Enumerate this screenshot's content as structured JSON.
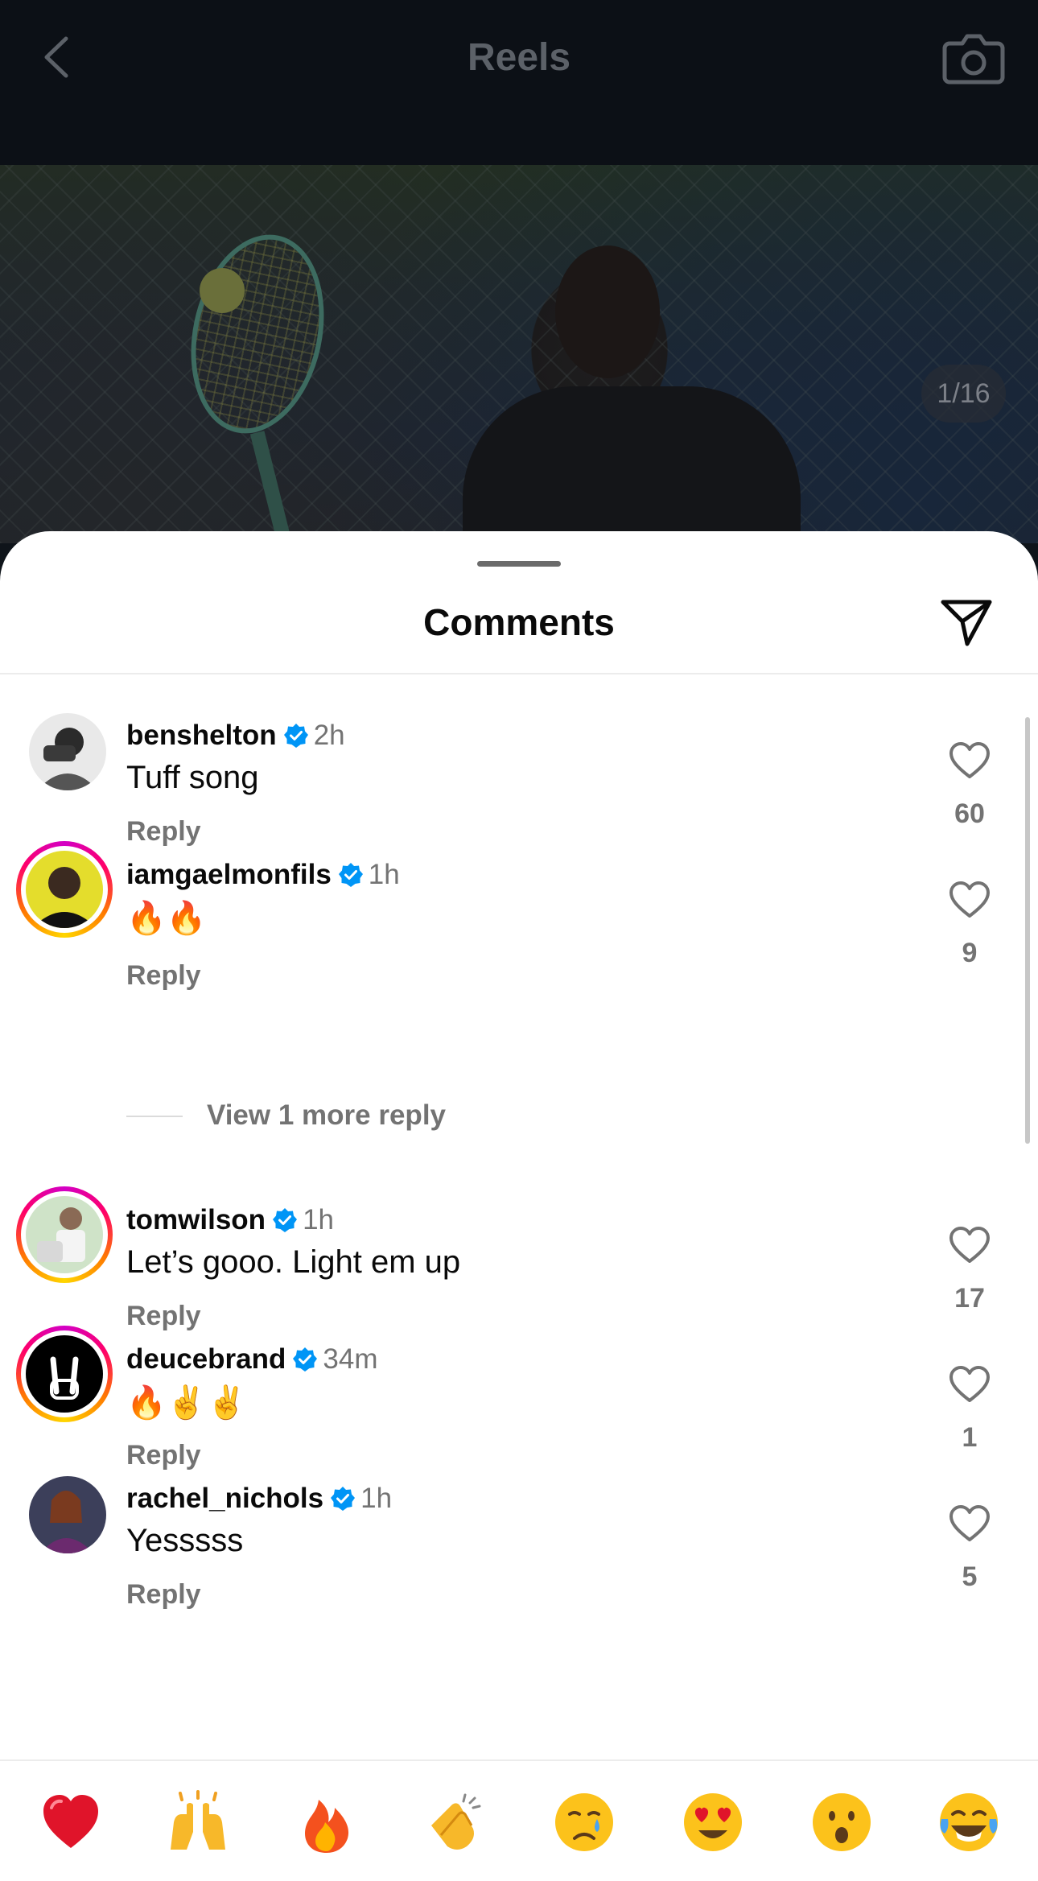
{
  "header": {
    "title": "Reels",
    "back_icon": "chevron-left-icon",
    "camera_icon": "camera-icon"
  },
  "media": {
    "counter": "1/16"
  },
  "sheet": {
    "title": "Comments",
    "share_icon": "send-icon"
  },
  "comments": [
    {
      "username": "benshelton",
      "verified": true,
      "time": "2h",
      "text": "Tuff song",
      "reply_label": "Reply",
      "likes": "60",
      "story_ring": false
    },
    {
      "username": "iamgaelmonfils",
      "verified": true,
      "time": "1h",
      "text": "🔥🔥",
      "reply_label": "Reply",
      "likes": "9",
      "story_ring": true
    },
    {
      "username": "tomwilson",
      "verified": true,
      "time": "1h",
      "text": "Let’s gooo. Light em up",
      "reply_label": "Reply",
      "likes": "17",
      "story_ring": true
    },
    {
      "username": "deucebrand",
      "verified": true,
      "time": "34m",
      "text": "🔥✌️✌️",
      "reply_label": "Reply",
      "likes": "1",
      "story_ring": true
    },
    {
      "username": "rachel_nichols",
      "verified": true,
      "time": "1h",
      "text": "Yesssss",
      "reply_label": "Reply",
      "likes": "5",
      "story_ring": false
    }
  ],
  "view_more_replies": "View 1 more reply",
  "reactions": [
    {
      "emoji": "❤️",
      "name": "red-heart-icon"
    },
    {
      "emoji": "🙌",
      "name": "raising-hands-icon"
    },
    {
      "emoji": "🔥",
      "name": "fire-icon"
    },
    {
      "emoji": "👏",
      "name": "clapping-hands-icon"
    },
    {
      "emoji": "😢",
      "name": "crying-face-icon"
    },
    {
      "emoji": "😍",
      "name": "heart-eyes-icon"
    },
    {
      "emoji": "😮",
      "name": "surprised-face-icon"
    },
    {
      "emoji": "😂",
      "name": "tears-of-joy-icon"
    }
  ],
  "colors": {
    "verified_blue": "#0095f6",
    "secondary_text": "#737373",
    "like_gray": "#737373"
  }
}
